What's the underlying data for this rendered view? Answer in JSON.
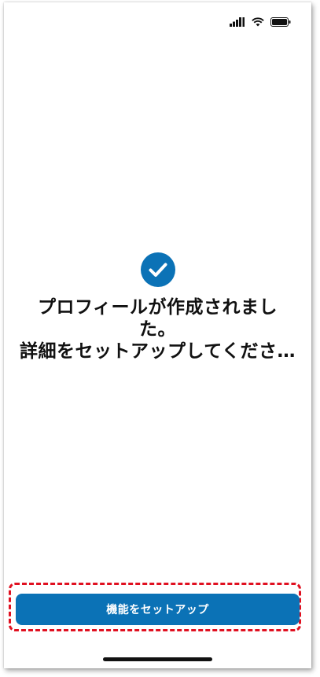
{
  "status_bar": {
    "icons": [
      "cellular-signal-icon",
      "wifi-icon",
      "battery-icon"
    ]
  },
  "main": {
    "icon": "check-circle-icon",
    "message_line1": "プロフィールが作成されまし",
    "message_line2": "た。",
    "message_line3": "詳細をセットアップしてくださ…"
  },
  "footer": {
    "setup_button_label": "機能をセットアップ"
  },
  "colors": {
    "accent": "#0b72b6",
    "highlight": "#e01020"
  }
}
